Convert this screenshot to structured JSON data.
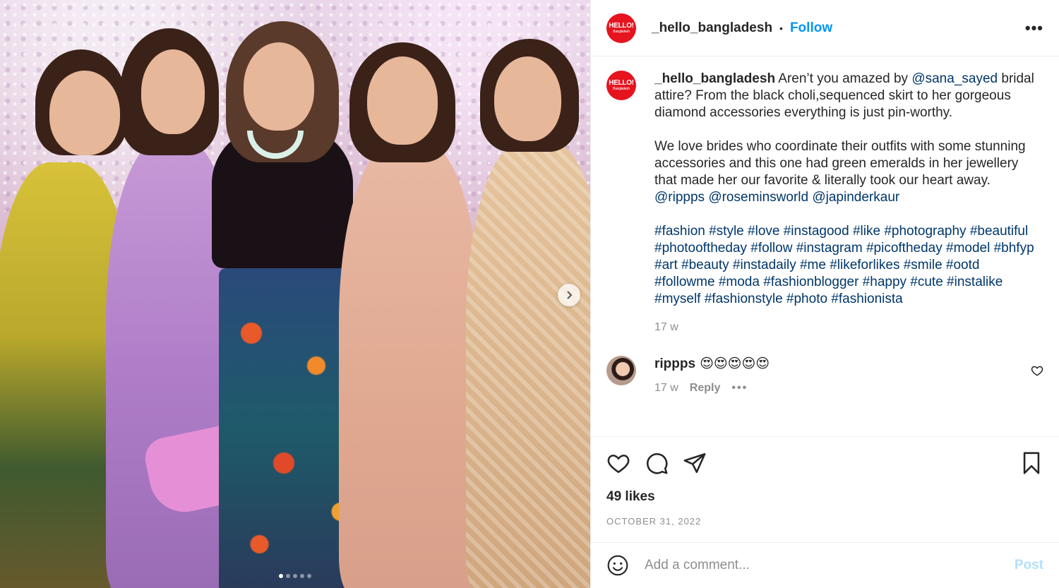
{
  "photo": {
    "description_icon": "carousel-next-icon",
    "slide_count": 5,
    "active_slide": 1
  },
  "header": {
    "logo_text": "HELLO!",
    "logo_sub": "Bangladesh",
    "username": "_hello_bangladesh",
    "separator": "•",
    "follow_label": "Follow",
    "more_label": "•••"
  },
  "caption": {
    "username": "_hello_bangladesh",
    "text1": " Aren’t you amazed by ",
    "mention1": "@sana_sayed",
    "text2": " bridal attire? From the black choli,sequenced skirt to her gorgeous diamond accessories everything is just pin-worthy.",
    "text3": "We love brides who coordinate their outfits with some stunning accessories and this one had green emeralds in her jewellery that made her our favorite & literally took our heart away.",
    "mentions": "@rippps @roseminsworld @japinderkaur",
    "hashtags": "#fashion #style #love #instagood #like #photography #beautiful #photooftheday #follow #instagram #picoftheday #model #bhfyp #art #beauty #instadaily #me #likeforlikes #smile #ootd #followme #moda #fashionblogger #happy #cute #instalike #myself #fashionstyle #photo #fashionista",
    "time": "17 w"
  },
  "comment": {
    "username": "rippps",
    "emojis": "😍😍😍😍😍",
    "time": "17 w",
    "reply_label": "Reply",
    "more_label": "•••"
  },
  "actions": {
    "likes": "49 likes",
    "date": "OCTOBER 31, 2022"
  },
  "comment_bar": {
    "placeholder": "Add a comment...",
    "post_label": "Post"
  },
  "colors": {
    "link_blue": "#0095f6",
    "hashtag": "#00376b",
    "brand_red": "#e5141f"
  }
}
